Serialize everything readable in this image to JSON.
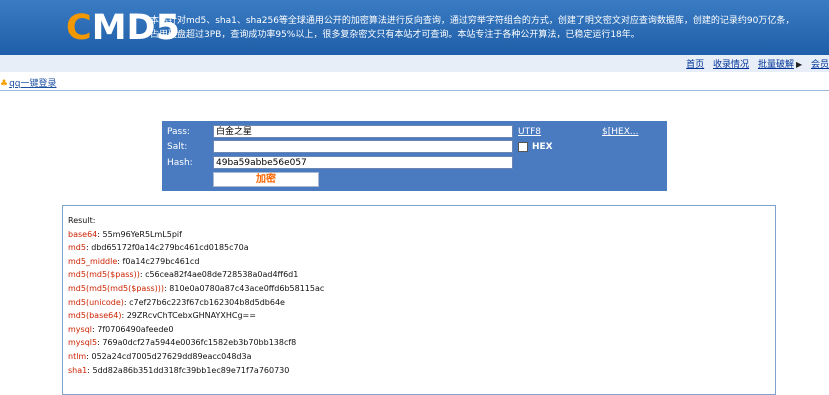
{
  "header": {
    "logo_c": "C",
    "logo_rest": "MD5",
    "intro_line1": "本站针对md5、sha1、sha256等全球通用公开的加密算法进行反向查询，通过穷举字符组合的方式，创建了明文密文对应查询数据库，创建的记录约90万亿条，",
    "intro_line2": "占用硬盘超过3PB，查询成功率95%以上，很多复杂密文只有本站才可查询。本站专注于各种公开算法，已稳定运行18年。"
  },
  "nav": {
    "home": "首页",
    "collect": "收录情况",
    "bulk": "批量破解",
    "member": "会员"
  },
  "qq": {
    "label": "qq一键登录"
  },
  "form": {
    "pass_label": "Pass:",
    "salt_label": "Salt:",
    "hash_label": "Hash:",
    "pass_value": "白金之星",
    "salt_value": "",
    "hash_value": "49ba59abbe56e057",
    "utf8_label": "UTF8",
    "hex_link": "$[HEX...",
    "hex_checkbox_label": "HEX",
    "submit_label": "加密"
  },
  "result": {
    "title": "Result:",
    "lines": [
      {
        "key": "base64",
        "value": "55m96YeR5LmL5pif"
      },
      {
        "key": "md5",
        "value": "dbd65172f0a14c279bc461cd0185c70a"
      },
      {
        "key": "md5_middle",
        "value": "f0a14c279bc461cd"
      },
      {
        "key": "md5(md5($pass))",
        "value": "c56cea82f4ae08de728538a0ad4ff6d1"
      },
      {
        "key": "md5(md5(md5($pass)))",
        "value": "810e0a0780a87c43ace0ffd6b58115ac"
      },
      {
        "key": "md5(unicode)",
        "value": "c7ef27b6c223f67cb162304b8d5db64e"
      },
      {
        "key": "md5(base64)",
        "value": "29ZRcvChTCebxGHNAYXHCg=="
      },
      {
        "key": "mysql",
        "value": "7f0706490afeede0"
      },
      {
        "key": "mysql5",
        "value": "769a0dcf27a5944e0036fc1582eb3b70bb138cf8"
      },
      {
        "key": "ntlm",
        "value": "052a24cd7005d27629dd89eacc048d3a"
      },
      {
        "key": "sha1",
        "value": "5dd82a86b351dd318fc39bb1ec89e71f7a760730"
      }
    ]
  }
}
